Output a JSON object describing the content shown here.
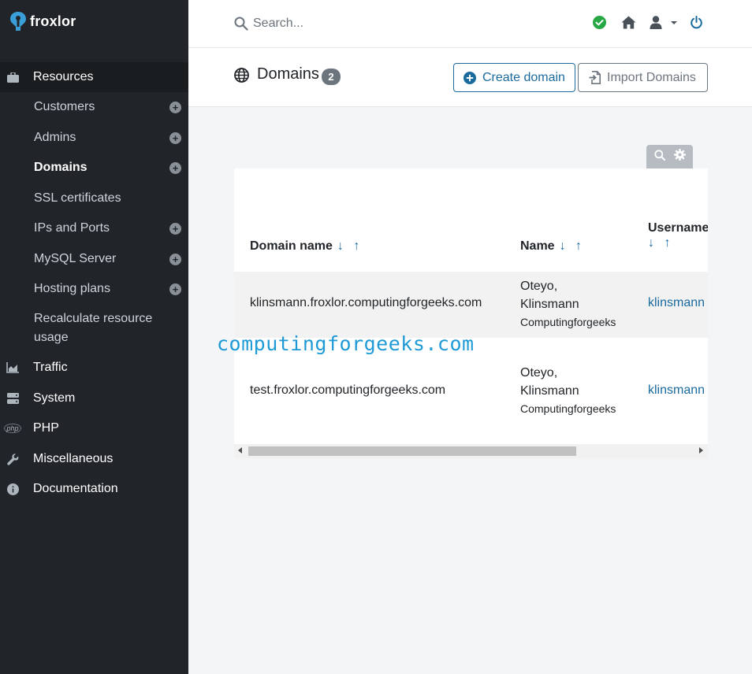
{
  "brand": {
    "name": "froxlor"
  },
  "search": {
    "placeholder": "Search..."
  },
  "sidebar": {
    "resources": "Resources",
    "items": {
      "customers": "Customers",
      "admins": "Admins",
      "domains": "Domains",
      "ssl": "SSL certificates",
      "ips": "IPs and Ports",
      "mysql": "MySQL Server",
      "hosting": "Hosting plans",
      "recalc": "Recalculate resource usage"
    },
    "traffic": "Traffic",
    "system": "System",
    "php": "PHP",
    "misc": "Miscellaneous",
    "docs": "Documentation",
    "php_glyph": "php"
  },
  "page": {
    "title": "Domains",
    "count": "2",
    "create_label": "Create domain",
    "import_label": "Import Domains"
  },
  "table": {
    "headers": {
      "domain": "Domain name",
      "name": "Name",
      "username": "Username"
    },
    "sort": "↓ ↑",
    "rows": [
      {
        "domain": "klinsmann.froxlor.computingforgeeks.com",
        "name_line1": "Oteyo,",
        "name_line2": "Klinsmann",
        "company": "Computingforgeeks",
        "username": "klinsmann"
      },
      {
        "domain": "test.froxlor.computingforgeeks.com",
        "name_line1": "Oteyo,",
        "name_line2": "Klinsmann",
        "company": "Computingforgeeks",
        "username": "klinsmann"
      }
    ]
  },
  "watermark": "computingforgeeks.com",
  "colors": {
    "sidebar": "#212529",
    "accent": "#1a6a9e",
    "status_ok": "#28a745"
  }
}
